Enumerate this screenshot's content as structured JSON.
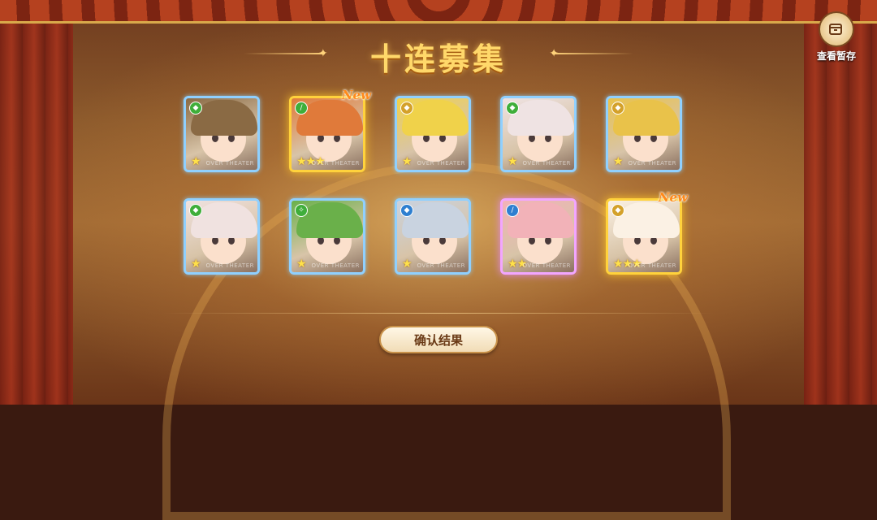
{
  "title": "十连募集",
  "stash": {
    "label": "查看暂存",
    "icon": "box-icon"
  },
  "confirm_label": "确认结果",
  "watermark": "OVER THEATER",
  "new_label": "New",
  "cards": [
    {
      "stars": "★",
      "rarity": 1,
      "class_color": "#3fae3a",
      "class_icon": "shield-icon",
      "hair": "#8a6a44",
      "is_new": false
    },
    {
      "stars": "★★★",
      "rarity": 3,
      "class_color": "#3fae3a",
      "class_icon": "sword-icon",
      "hair": "#e07a3a",
      "is_new": true
    },
    {
      "stars": "★",
      "rarity": 1,
      "class_color": "#d4a12a",
      "class_icon": "shield-icon",
      "hair": "#f0d24a",
      "is_new": false
    },
    {
      "stars": "★",
      "rarity": 1,
      "class_color": "#3fae3a",
      "class_icon": "shield-icon",
      "hair": "#efe3e3",
      "is_new": false
    },
    {
      "stars": "★",
      "rarity": 1,
      "class_color": "#d4a12a",
      "class_icon": "shield-icon",
      "hair": "#e9c24a",
      "is_new": false
    },
    {
      "stars": "★",
      "rarity": 1,
      "class_color": "#3fae3a",
      "class_icon": "shield-icon",
      "hair": "#f0e2e0",
      "is_new": false
    },
    {
      "stars": "★",
      "rarity": 1,
      "class_color": "#3fae3a",
      "class_icon": "staff-icon",
      "hair": "#6ab04a",
      "is_new": false
    },
    {
      "stars": "★",
      "rarity": 1,
      "class_color": "#2e7fd0",
      "class_icon": "shield-icon",
      "hair": "#c9d3e0",
      "is_new": false
    },
    {
      "stars": "★★",
      "rarity": 2,
      "class_color": "#2e7fd0",
      "class_icon": "sword-icon",
      "hair": "#f2b2b8",
      "is_new": false
    },
    {
      "stars": "★★★",
      "rarity": 3,
      "class_color": "#d4a12a",
      "class_icon": "shield-icon",
      "hair": "#fbf1e4",
      "is_new": true
    }
  ]
}
